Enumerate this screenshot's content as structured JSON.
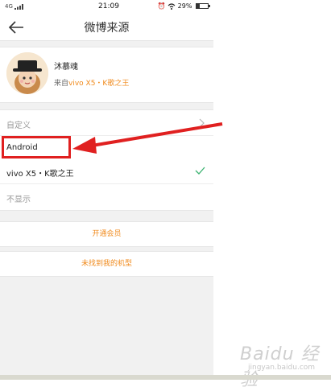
{
  "status_bar": {
    "network": "4G",
    "time": "21:09",
    "battery": "29%",
    "battery_level": 0.29
  },
  "header": {
    "title": "微博来源"
  },
  "profile": {
    "name": "沐慕魂",
    "source_prefix": "来自",
    "source_device": "vivo X5・K歌之王"
  },
  "options": [
    {
      "label": "自定义"
    },
    {
      "label": "Android"
    },
    {
      "label": "vivo X5・K歌之王"
    },
    {
      "label": "不显示"
    }
  ],
  "buttons": {
    "vip": "开通会员",
    "not_found": "未找到我的机型"
  },
  "colors": {
    "accent": "#f08a1c",
    "annotation": "#e02020",
    "check": "#3cb371"
  },
  "watermark": {
    "text": "Baidu 经验",
    "sub": "jingyan.baidu.com"
  }
}
